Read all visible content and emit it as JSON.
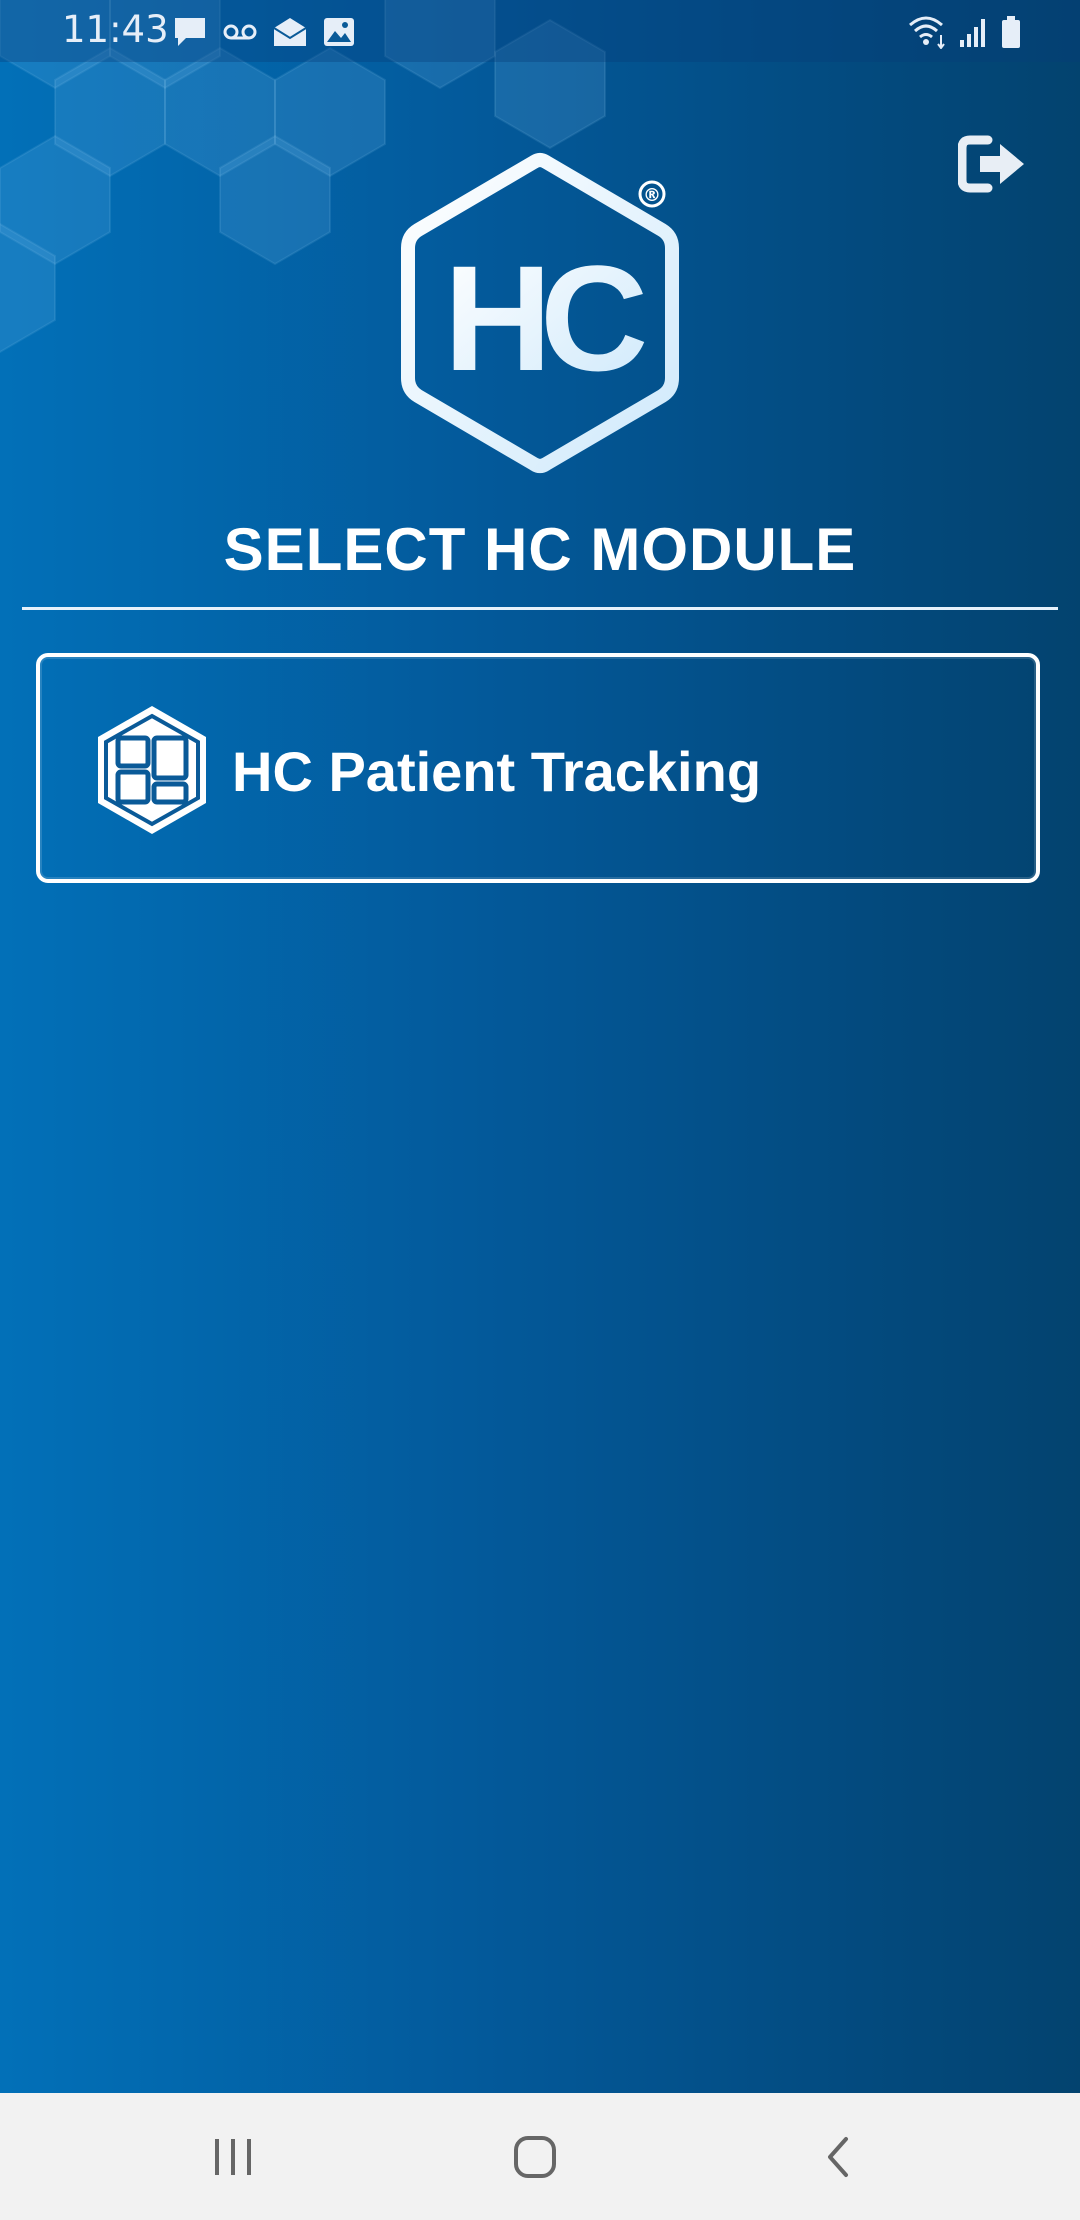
{
  "status_bar": {
    "time": "11:43",
    "left_icons": [
      "chat-icon",
      "voicemail-icon",
      "mail-open-icon",
      "image-icon"
    ],
    "right_icons": [
      "wifi-icon",
      "signal-icon",
      "battery-icon"
    ]
  },
  "header": {
    "logo_text": "HC",
    "logo_mark": "®",
    "logout_icon": "logout-icon"
  },
  "main": {
    "title": "SELECT HC MODULE",
    "modules": [
      {
        "label": "HC Patient Tracking",
        "icon": "patient-tracking-icon"
      }
    ]
  },
  "nav_bar": {
    "buttons": [
      "recent-apps-icon",
      "home-icon",
      "back-icon"
    ]
  },
  "colors": {
    "background_start": "#0270b8",
    "background_end": "#03436f",
    "foreground": "#ffffff",
    "nav_bar": "#f2f2f2"
  }
}
